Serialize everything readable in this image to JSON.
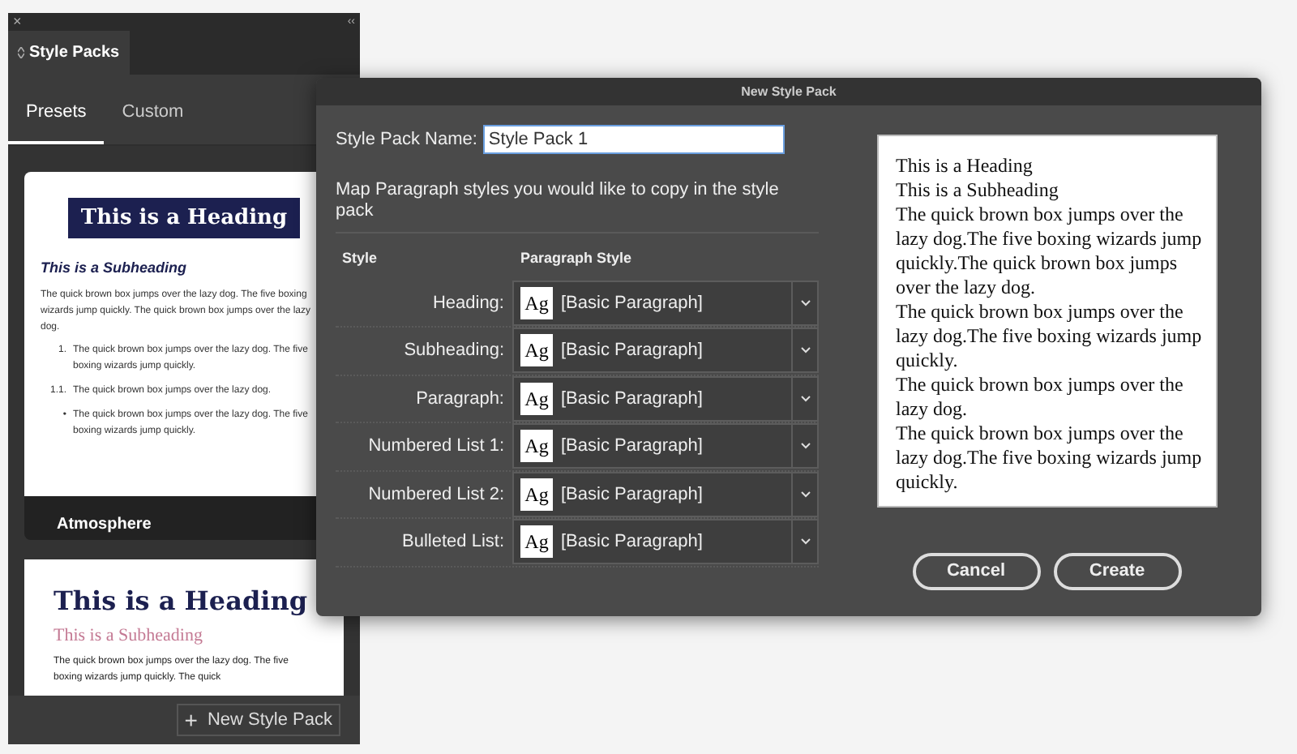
{
  "panel": {
    "close": "×",
    "collapse": "‹‹",
    "title": "Style Packs",
    "tabs": [
      {
        "label": "Presets",
        "selected": true
      },
      {
        "label": "Custom",
        "selected": false
      }
    ],
    "cards": [
      {
        "kind": "boxed",
        "heading": "This is a Heading",
        "subheading": "This is a Subheading",
        "paragraph": "The quick brown box jumps over the lazy dog. The five boxing wizards jump quickly. The quick brown box jumps over the lazy dog.",
        "list": [
          {
            "marker": "1.",
            "text": "The quick brown box jumps over the lazy dog. The five boxing wizards jump quickly."
          },
          {
            "marker": "1.1.",
            "text": "The quick brown box jumps over the lazy dog."
          },
          {
            "marker": "•",
            "text": "The quick brown box jumps over the lazy dog. The five boxing wizards jump quickly."
          }
        ],
        "name": "Atmosphere"
      },
      {
        "kind": "serif",
        "heading": "This is a Heading",
        "subheading": "This is a Subheading",
        "paragraph": "The quick brown box jumps over the lazy dog. The five boxing wizards jump quickly. The quick"
      }
    ],
    "new_button": {
      "icon": "+",
      "label": "New Style Pack"
    }
  },
  "dialog": {
    "title": "New Style Pack",
    "name_label": "Style Pack Name:",
    "name_value": "Style Pack 1",
    "instructions": "Map Paragraph styles you would like to copy in the style pack",
    "columns": [
      "Style",
      "Paragraph Style"
    ],
    "rows": [
      {
        "style": "Heading:",
        "swatch": "Ag",
        "value": "[Basic Paragraph]"
      },
      {
        "style": "Subheading:",
        "swatch": "Ag",
        "value": "[Basic Paragraph]"
      },
      {
        "style": "Paragraph:",
        "swatch": "Ag",
        "value": "[Basic Paragraph]"
      },
      {
        "style": "Numbered List 1:",
        "swatch": "Ag",
        "value": "[Basic Paragraph]"
      },
      {
        "style": "Numbered List 2:",
        "swatch": "Ag",
        "value": "[Basic Paragraph]"
      },
      {
        "style": "Bulleted List:",
        "swatch": "Ag",
        "value": "[Basic Paragraph]"
      }
    ],
    "preview": [
      "This is a Heading",
      "This is a Subheading",
      "The quick brown box jumps over the lazy dog.The five boxing wizards jump quickly.The quick brown box jumps over the lazy dog.",
      "The quick brown box jumps over the lazy dog.The five boxing wizards jump quickly.",
      "The quick brown box jumps over the lazy dog.",
      "The quick brown box jumps over the lazy dog.The five boxing wizards jump quickly."
    ],
    "buttons": [
      "Cancel",
      "Create"
    ]
  }
}
